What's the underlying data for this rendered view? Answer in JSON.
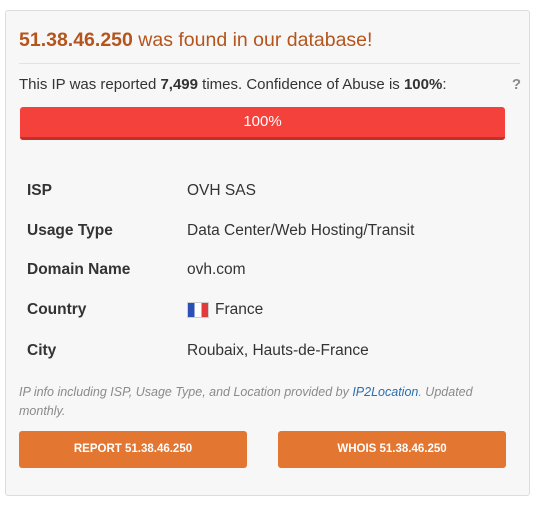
{
  "heading": {
    "ip": "51.38.46.250",
    "text": " was found in our database!"
  },
  "summary": {
    "prefix": "This IP was reported ",
    "count": "7,499",
    "middle": " times. Confidence of Abuse is ",
    "confidence": "100%",
    "suffix": ":",
    "help": "?"
  },
  "progress": {
    "value": 1.0,
    "label": "100%",
    "color": "#f5413b"
  },
  "info": [
    {
      "label": "ISP",
      "value": "OVH SAS"
    },
    {
      "label": "Usage Type",
      "value": "Data Center/Web Hosting/Transit"
    },
    {
      "label": "Domain Name",
      "value": "ovh.com"
    },
    {
      "label": "Country",
      "value": "France",
      "icon": "france-flag-icon"
    },
    {
      "label": "City",
      "value": "Roubaix, Hauts-de-France"
    }
  ],
  "note": {
    "before": "IP info including ISP, Usage Type, and Location provided by ",
    "link": "IP2Location",
    "after": ". Updated monthly."
  },
  "buttons": {
    "report": "REPORT 51.38.46.250",
    "whois": "WHOIS 51.38.46.250"
  },
  "colors": {
    "accent": "#b5541c",
    "button": "#e37631",
    "link": "#2a6fb0"
  }
}
